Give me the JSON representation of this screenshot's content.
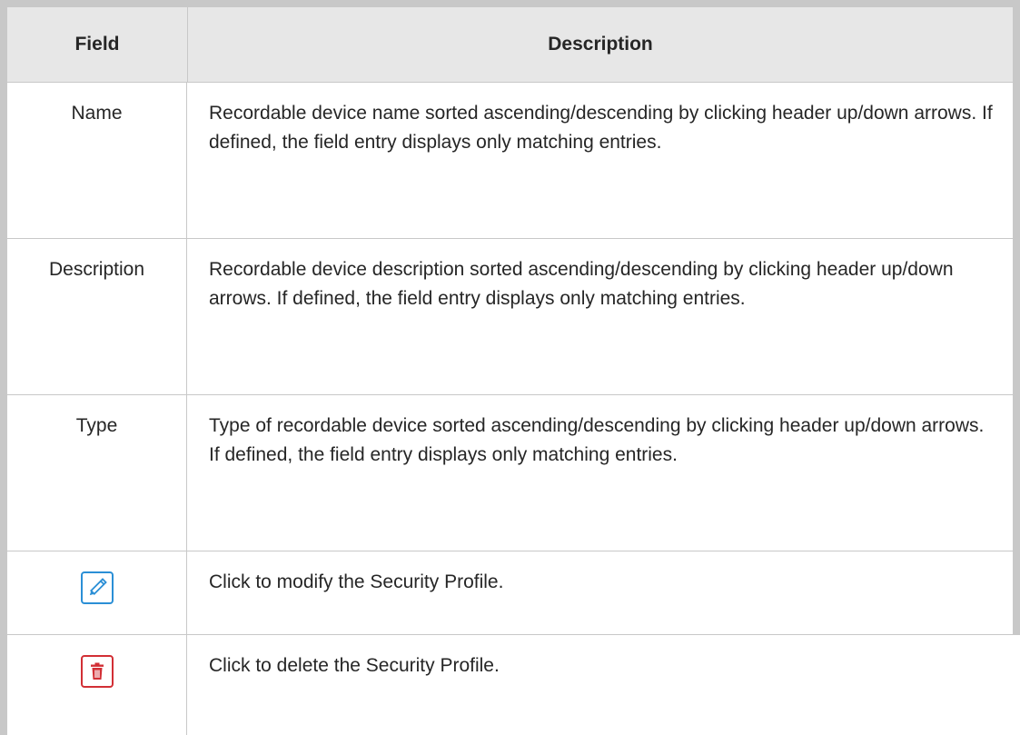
{
  "table": {
    "headers": {
      "field": "Field",
      "description": "Description"
    },
    "rows": [
      {
        "field": "Name",
        "description": "Recordable device name sorted ascending/descending by clicking header up/down arrows. If defined, the field entry displays only matching entries."
      },
      {
        "field": "Description",
        "description": "Recordable device description sorted ascending/descending by clicking header up/down arrows. If defined, the field entry displays only matching entries."
      },
      {
        "field": "Type",
        "description": "Type of recordable device sorted ascending/descending by clicking header up/down arrows. If defined, the field entry displays only matching entries."
      },
      {
        "field_icon": "pencil-icon",
        "description": "Click to modify the Security Profile."
      },
      {
        "field_icon": "trash-icon",
        "description": "Click to delete the Security Profile."
      }
    ]
  },
  "colors": {
    "edit_accent": "#2b8fd6",
    "delete_accent": "#d22f35",
    "header_bg": "#e7e7e7",
    "border": "#c8c8c8"
  }
}
